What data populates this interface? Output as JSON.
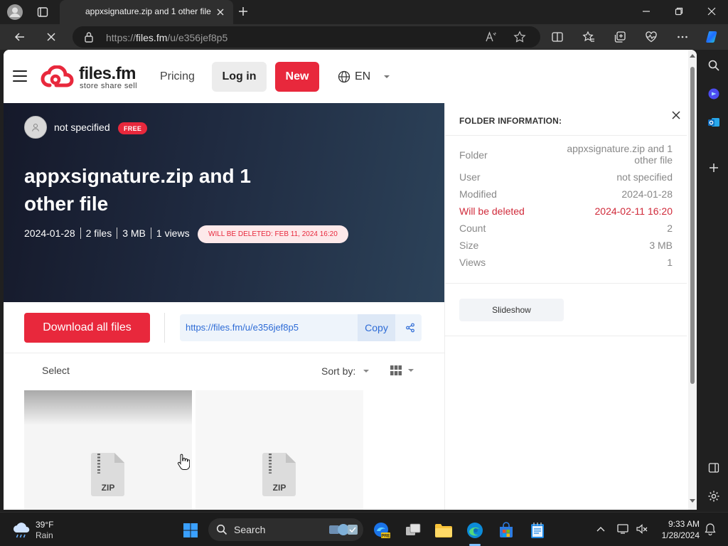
{
  "browser": {
    "tab_title": "appxsignature.zip and 1 other file",
    "address": {
      "prefix": "https://",
      "domain": "files.fm",
      "path": "/u/e356jef8p5"
    }
  },
  "site": {
    "logo_text": "files.fm",
    "logo_sub": "store share sell",
    "nav_pricing": "Pricing",
    "login_label": "Log in",
    "new_label": "New",
    "lang_label": "EN"
  },
  "hero": {
    "owner": "not specified",
    "badge": "FREE",
    "title": "appxsignature.zip and 1 other file",
    "stats": [
      "2024-01-28",
      "2 files",
      "3 MB",
      "1 views"
    ],
    "delete_notice": "WILL BE DELETED: FEB 11, 2024 16:20"
  },
  "actions": {
    "download_label": "Download all files",
    "share_url": "https://files.fm/u/e356jef8p5",
    "copy_label": "Copy"
  },
  "list": {
    "select_label": "Select",
    "sort_label": "Sort by:"
  },
  "files": [
    {
      "type_label": "ZIP"
    },
    {
      "type_label": "ZIP"
    }
  ],
  "panel": {
    "title": "FOLDER INFORMATION:",
    "rows": [
      {
        "key": "Folder",
        "value": "appxsignature.zip and 1 other file"
      },
      {
        "key": "User",
        "value": "not specified"
      },
      {
        "key": "Modified",
        "value": "2024-01-28"
      },
      {
        "key": "Will be deleted",
        "value": "2024-02-11 16:20"
      },
      {
        "key": "Count",
        "value": "2"
      },
      {
        "key": "Size",
        "value": "3 MB"
      },
      {
        "key": "Views",
        "value": "1"
      }
    ],
    "slideshow_label": "Slideshow"
  },
  "taskbar": {
    "weather_temp": "39°F",
    "weather_cond": "Rain",
    "search_label": "Search",
    "time": "9:33 AM",
    "date": "1/28/2024"
  },
  "colors": {
    "brand_red": "#e8283c",
    "link_blue": "#2d6bd6",
    "hero_dark": "#15192a"
  },
  "icons": [
    "profile-icon",
    "tab-actions-icon",
    "close-icon",
    "new-tab-icon",
    "minimize-icon",
    "restore-icon",
    "back-icon",
    "loading-icon",
    "lock-icon",
    "read-aloud-icon",
    "favorite-icon",
    "split-screen-icon",
    "favorites-icon",
    "collections-icon",
    "health-icon",
    "more-icon",
    "copilot-icon",
    "globe-icon",
    "chevron-down-icon",
    "share-icon",
    "grid-view-icon",
    "zip-file-icon",
    "hand-cursor-icon"
  ]
}
